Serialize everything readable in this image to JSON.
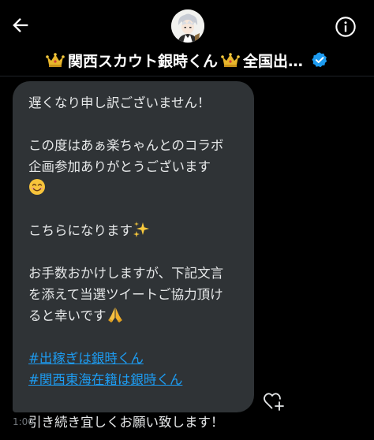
{
  "header": {
    "back_icon": "arrow-left-icon",
    "info_icon": "info-icon",
    "crown_icon": "crown-emoji",
    "title": "関西スカウト銀時くん",
    "title_suffix": "全国出…",
    "verified_icon": "verified-badge-icon",
    "verified_color": "#1d9bf0"
  },
  "message": {
    "lines": [
      "遅くなり申し訳ございません！",
      "この度はあぁ楽ちゃんとのコラボ",
      "企画参加ありがとうございます",
      "こちらになります",
      "お手数おかけしますが、下記文言",
      "を添えて当選ツイートご協力頂け",
      "ると幸いです",
      "引き続き宜しくお願い致します！"
    ],
    "hashtags": [
      "#出稼ぎは銀時くん",
      "#関西東海在籍は銀時くん"
    ],
    "emojis": [
      "smiling-face-emoji",
      "sparkles-emoji",
      "folded-hands-emoji"
    ],
    "timestamp": "1:00"
  },
  "colors": {
    "background": "#000000",
    "bubble": "#2f3336",
    "text": "#e7e9ea",
    "link": "#1d9bf0",
    "muted": "#71767b"
  }
}
